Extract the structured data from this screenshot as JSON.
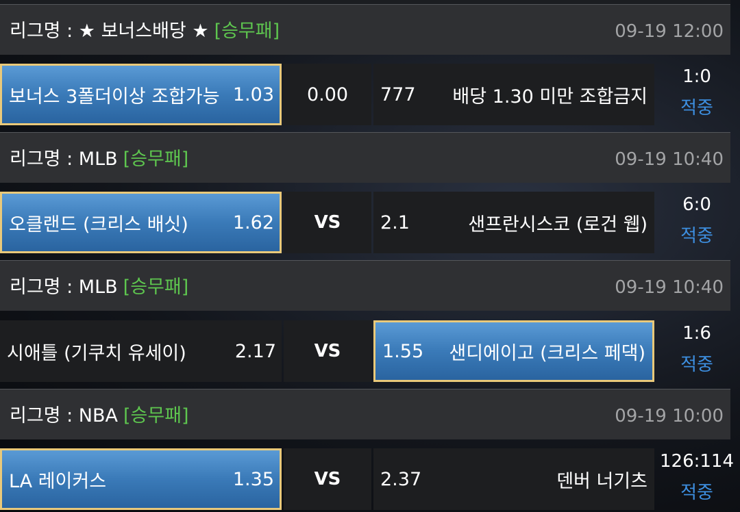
{
  "events": [
    {
      "league_label": "리그명 : ★ 보너스배당 ★",
      "bet_type": "[승무패]",
      "datetime": "09-19 12:00",
      "home": {
        "name": "보너스 3폴더이상 조합가능",
        "odds": "1.03",
        "selected": true
      },
      "middle": "0.00",
      "away": {
        "name": "배당 1.30 미만 조합금지",
        "odds": "777",
        "selected": false
      },
      "score": "1:0",
      "status": "적중"
    },
    {
      "league_label": "리그명 : MLB",
      "bet_type": "[승무패]",
      "datetime": "09-19 10:40",
      "home": {
        "name": "오클랜드 (크리스 배싯)",
        "odds": "1.62",
        "selected": true
      },
      "middle": "VS",
      "away": {
        "name": "샌프란시스코 (로건 웹)",
        "odds": "2.1",
        "selected": false
      },
      "score": "6:0",
      "status": "적중"
    },
    {
      "league_label": "리그명 : MLB",
      "bet_type": "[승무패]",
      "datetime": "09-19 10:40",
      "home": {
        "name": "시애틀 (기쿠치 유세이)",
        "odds": "2.17",
        "selected": false
      },
      "middle": "VS",
      "away": {
        "name": "샌디에이고 (크리스 페댁)",
        "odds": "1.55",
        "selected": true
      },
      "score": "1:6",
      "status": "적중"
    },
    {
      "league_label": "리그명 : NBA",
      "bet_type": "[승무패]",
      "datetime": "09-19 10:00",
      "home": {
        "name": "LA 레이커스",
        "odds": "1.35",
        "selected": true
      },
      "middle": "VS",
      "away": {
        "name": "덴버 너기츠",
        "odds": "2.37",
        "selected": false
      },
      "score": "126:114",
      "status": "적중"
    }
  ],
  "colors": {
    "header_bg": "#2f3033",
    "cell_bg": "#1d1e20",
    "selected_gradient_top": "#5a9ad5",
    "selected_border": "#e9c97a",
    "tag_green": "#5ec64f",
    "status_blue": "#3d8fe0",
    "time_gray": "#a3a4a6"
  }
}
